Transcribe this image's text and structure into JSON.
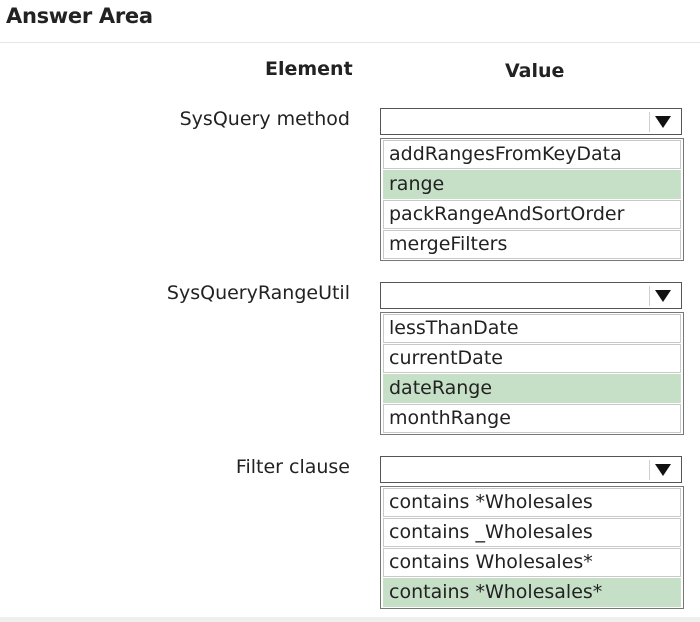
{
  "title": "Answer Area",
  "headers": {
    "element": "Element",
    "value": "Value"
  },
  "rows": [
    {
      "label": "SysQuery method",
      "dropdown_value": "",
      "options": [
        {
          "text": "addRangesFromKeyData",
          "selected": false
        },
        {
          "text": "range",
          "selected": true
        },
        {
          "text": "packRangeAndSortOrder",
          "selected": false
        },
        {
          "text": "mergeFilters",
          "selected": false
        }
      ]
    },
    {
      "label": "SysQueryRangeUtil",
      "dropdown_value": "",
      "options": [
        {
          "text": "lessThanDate",
          "selected": false
        },
        {
          "text": "currentDate",
          "selected": false
        },
        {
          "text": "dateRange",
          "selected": true
        },
        {
          "text": "monthRange",
          "selected": false
        }
      ]
    },
    {
      "label": "Filter clause",
      "dropdown_value": "",
      "options": [
        {
          "text": "contains *Wholesales",
          "selected": false
        },
        {
          "text": "contains _Wholesales",
          "selected": false
        },
        {
          "text": "contains Wholesales*",
          "selected": false
        },
        {
          "text": "contains *Wholesales*",
          "selected": true
        }
      ]
    }
  ],
  "colors": {
    "selected_option": "#c6e0c7",
    "border": "#555555"
  },
  "icons": {
    "dropdown": "triangle-down-icon"
  }
}
